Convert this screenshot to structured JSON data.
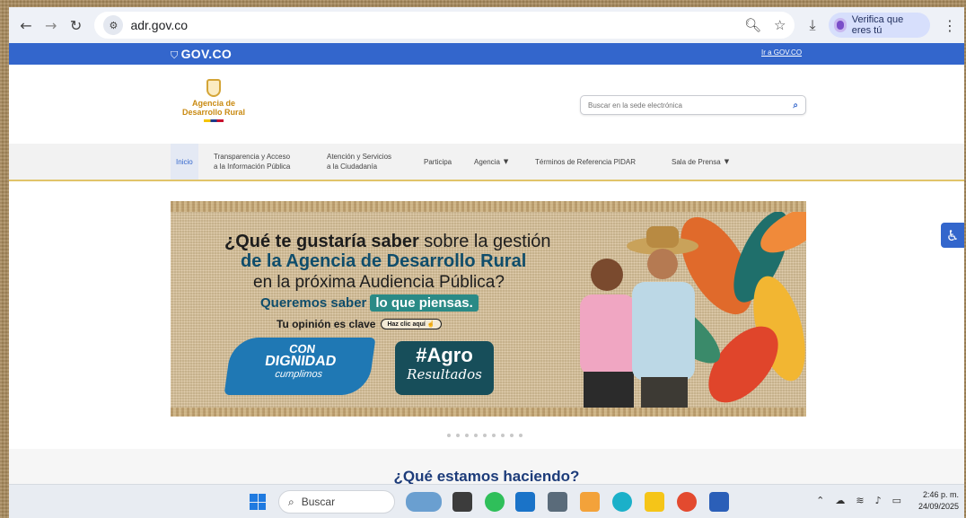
{
  "browser": {
    "url": "adr.gov.co",
    "verify_label": "Verifica que eres tú"
  },
  "govbar": {
    "logo": "GOV.CO",
    "link": "Ir a GOV.CO"
  },
  "header": {
    "agency_line1": "Agencia de",
    "agency_line2": "Desarrollo Rural",
    "search_placeholder": "Buscar en la sede electrónica"
  },
  "nav": {
    "items": [
      {
        "label": "Inicio"
      },
      {
        "label1": "Transparencia y Acceso",
        "label2": "a la Información Pública"
      },
      {
        "label1": "Atención y Servicios",
        "label2": "a la Ciudadanía"
      },
      {
        "label": "Participa"
      },
      {
        "label": "Agencia"
      },
      {
        "label": "Términos de Referencia PIDAR"
      },
      {
        "label": "Sala de Prensa"
      }
    ]
  },
  "hero": {
    "line1_bold": "¿Qué te gustaría saber",
    "line1_rest": " sobre la gestión",
    "line2": "de la Agencia de Desarrollo Rural",
    "line3": "en la próxima Audiencia Pública?",
    "line4a": "Queremos saber",
    "line4b": "lo que piensas.",
    "line5": "Tu opinión es clave",
    "click_label": "Haz clic aquí",
    "badge1_a": "CON",
    "badge1_b": "DIGNIDAD",
    "badge1_c": "cumplimos",
    "badge2_a": "#Agro",
    "badge2_b": "Resultados"
  },
  "section": {
    "title": "¿Qué estamos haciendo?"
  },
  "taskbar": {
    "search_label": "Buscar",
    "time": "2:46 p. m.",
    "date": "24/09/2025"
  },
  "colors": {
    "gov_blue": "#3366cc",
    "nav_gold": "#e1c46a",
    "brand_teal": "#0f4d6b"
  }
}
